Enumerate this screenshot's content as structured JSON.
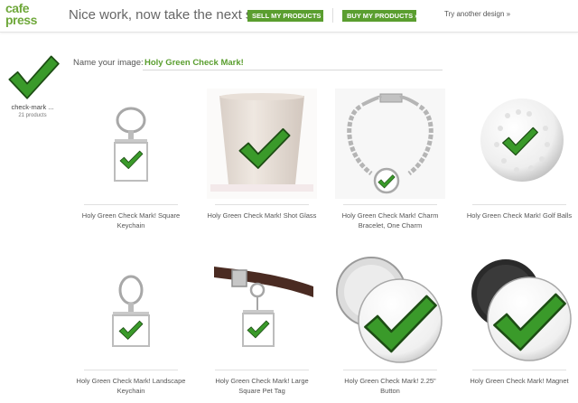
{
  "header": {
    "logo_line1": "cafe",
    "logo_line2": "press",
    "headline": "Nice work, now take the next step:",
    "sell_label": "SELL MY PRODUCTS »",
    "buy_label": "BUY MY PRODUCTS »",
    "try_label": "Try another design »"
  },
  "design": {
    "name": "check-mark ...",
    "count": "21 products"
  },
  "name_field": {
    "label": "Name your image:",
    "value": "Holy Green Check Mark!"
  },
  "colors": {
    "brand_green": "#6fa83b",
    "button_green": "#5a9e2f",
    "check_green": "#3a9a2a"
  },
  "products": [
    {
      "title": "Holy Green Check Mark! Square Keychain",
      "icon": "square-keychain-icon"
    },
    {
      "title": "Holy Green Check Mark! Shot Glass",
      "icon": "shot-glass-icon"
    },
    {
      "title": "Holy Green Check Mark! Charm Bracelet, One Charm",
      "icon": "charm-bracelet-icon"
    },
    {
      "title": "Holy Green Check Mark! Golf Balls",
      "icon": "golf-ball-icon"
    },
    {
      "title": "Holy Green Check Mark! Landscape Keychain",
      "icon": "landscape-keychain-icon"
    },
    {
      "title": "Holy Green Check Mark! Large Square Pet Tag",
      "icon": "pet-tag-icon"
    },
    {
      "title": "Holy Green Check Mark! 2.25\" Button",
      "icon": "button-pin-icon"
    },
    {
      "title": "Holy Green Check Mark! Magnet",
      "icon": "magnet-icon"
    }
  ]
}
